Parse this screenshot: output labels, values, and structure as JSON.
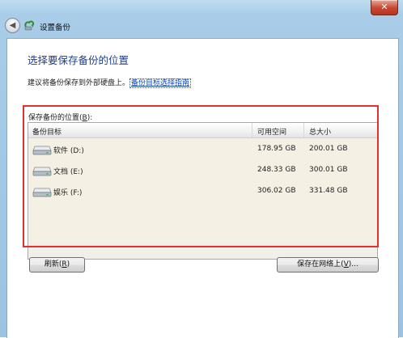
{
  "window": {
    "title": "设置备份",
    "close_label": "✕"
  },
  "page": {
    "heading": "选择要保存备份的位置",
    "advice_text": "建议将备份保存到外部硬盘上。",
    "advice_link": "备份目标选择指南"
  },
  "group": {
    "label_prefix": "保存备份的位置(",
    "label_key": "B",
    "label_suffix": "):"
  },
  "table": {
    "columns": [
      "备份目标",
      "可用空间",
      "总大小"
    ],
    "rows": [
      {
        "name": "软件 (D:)",
        "free": "178.95 GB",
        "total": "200.01 GB"
      },
      {
        "name": "文档 (E:)",
        "free": "248.33 GB",
        "total": "300.01 GB"
      },
      {
        "name": "娱乐 (F:)",
        "free": "306.02 GB",
        "total": "331.48 GB"
      }
    ]
  },
  "buttons": {
    "refresh_prefix": "刷新(",
    "refresh_key": "R",
    "refresh_suffix": ")",
    "network_prefix": "保存在网络上(",
    "network_key": "V",
    "network_suffix": ")..."
  },
  "colors": {
    "highlight": "#e5312b",
    "heading": "#1e3f8a",
    "link": "#0e45b5"
  },
  "icons": {
    "back": "back-arrow-icon",
    "app": "backup-icon",
    "drive": "hard-drive-icon"
  }
}
